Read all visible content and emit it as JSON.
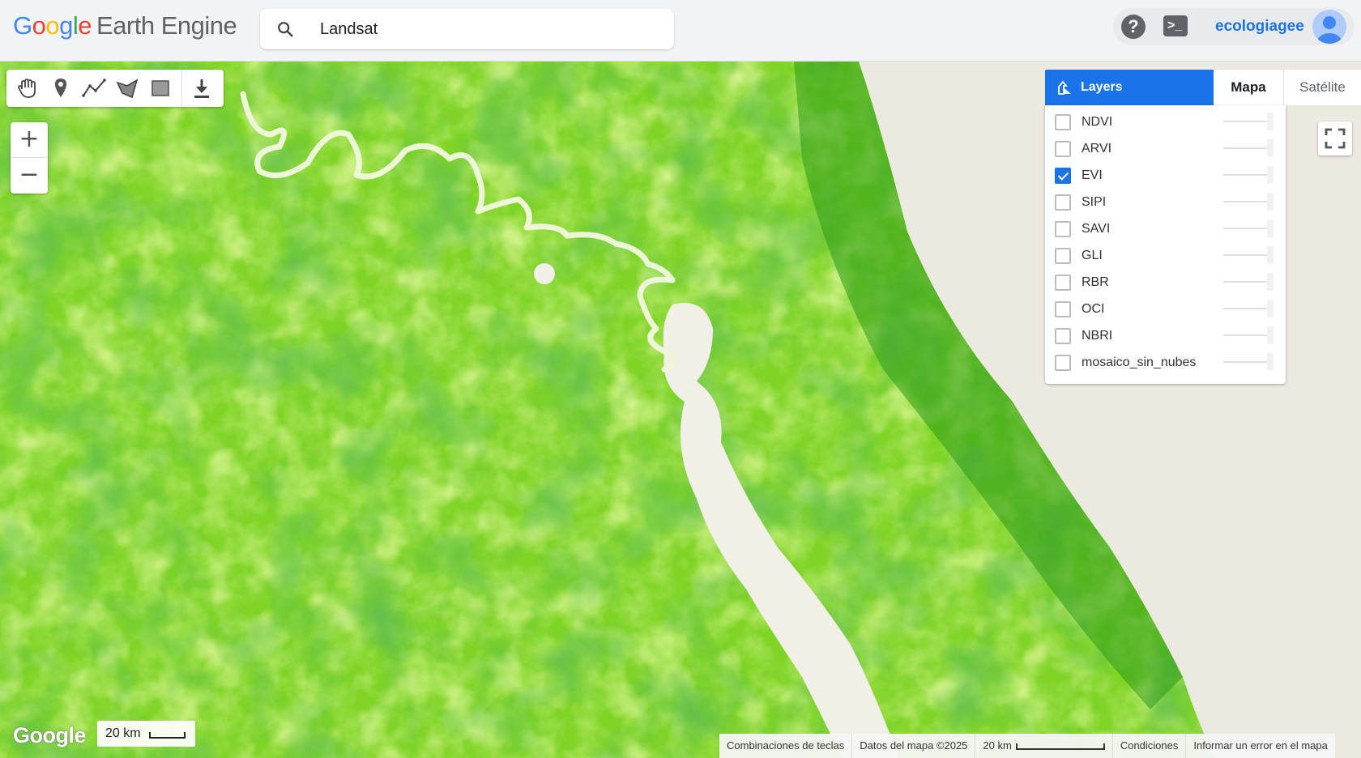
{
  "header": {
    "logo_google": [
      "G",
      "o",
      "o",
      "g",
      "l",
      "e"
    ],
    "logo_product": "Earth Engine",
    "search_value": "Landsat",
    "username": "ecologiagee",
    "icons": [
      "search-icon",
      "help-icon",
      "terminal-icon",
      "avatar-icon"
    ]
  },
  "toolbar": {
    "tools": [
      "hand-icon",
      "marker-icon",
      "line-icon",
      "polygon-icon",
      "rectangle-icon",
      "download-icon"
    ]
  },
  "zoom": {
    "in": "+",
    "out": "−"
  },
  "layers": {
    "tab_layers": "Layers",
    "tab_map": "Mapa",
    "tab_satellite": "Satélite",
    "items": [
      {
        "name": "NDVI",
        "checked": false
      },
      {
        "name": "ARVI",
        "checked": false
      },
      {
        "name": "EVI",
        "checked": true
      },
      {
        "name": "SIPI",
        "checked": false
      },
      {
        "name": "SAVI",
        "checked": false
      },
      {
        "name": "GLI",
        "checked": false
      },
      {
        "name": "RBR",
        "checked": false
      },
      {
        "name": "OCI",
        "checked": false
      },
      {
        "name": "NBRI",
        "checked": false
      },
      {
        "name": "mosaico_sin_nubes",
        "checked": false
      }
    ]
  },
  "map": {
    "watermark": "Google",
    "scale_left": "20 km",
    "attribution": {
      "shortcuts": "Combinaciones de teclas",
      "data": "Datos del mapa ©2025",
      "scale": "20 km",
      "terms": "Condiciones",
      "report": "Informar un error en el mapa"
    },
    "colors": {
      "vegetation_light": "#b8ea3a",
      "vegetation_mid": "#6cc91e",
      "vegetation_dark": "#1f8a12",
      "water": "#f2efe6",
      "land_outside": "#ece9e0",
      "accent": "#1a73e8"
    }
  }
}
